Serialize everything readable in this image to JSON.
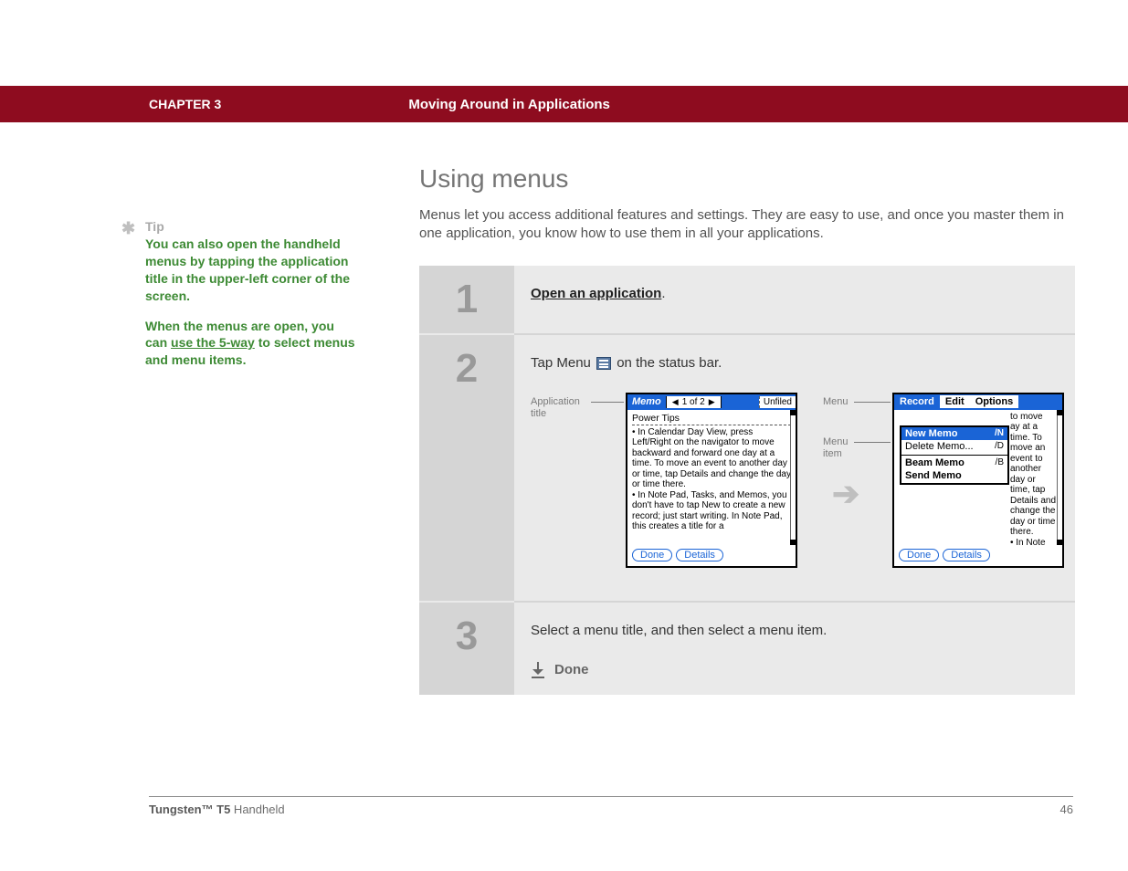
{
  "header": {
    "chapter": "CHAPTER 3",
    "title": "Moving Around in Applications"
  },
  "tip": {
    "label": "Tip",
    "p1": "You can also open the handheld menus by tapping the application title in the upper-left corner of the screen.",
    "p2a": "When the menus are open, you can ",
    "p2link": "use the 5-way",
    "p2b": " to select menus and menu items."
  },
  "section": {
    "title": "Using menus",
    "intro": "Menus let you access additional features and settings. They are easy to use, and once you master them in one application, you know how to use them in all your applications."
  },
  "steps": {
    "s1": {
      "num": "1",
      "link": "Open an application",
      "after": "."
    },
    "s2": {
      "num": "2",
      "prefix": "Tap Menu ",
      "suffix": " on the status bar.",
      "labels": {
        "app_title": "Application title",
        "menu": "Menu",
        "menu_item": "Menu item"
      },
      "shot1": {
        "app": "Memo",
        "nav": "1 of 2",
        "cat": "Unfiled",
        "heading": "Power Tips",
        "body": "• In Calendar Day View, press Left/Right on the navigator to move backward and forward one day at a time. To move an event to another day or time, tap Details and change the day or time there.\n• In Note Pad, Tasks, and Memos, you don't have to tap New to create a new record; just start writing. In Note Pad, this creates a title for a",
        "btn_done": "Done",
        "btn_details": "Details"
      },
      "shot2": {
        "menus": {
          "record": "Record",
          "edit": "Edit",
          "options": "Options"
        },
        "items": {
          "new_memo": "New Memo",
          "new_sc": "/N",
          "delete_memo": "Delete Memo...",
          "delete_sc": "/D",
          "beam_memo": "Beam Memo",
          "beam_sc": "/B",
          "send_memo": "Send Memo"
        },
        "body_tail": "to move\nay at a\ntime. To move an event to another day or time, tap Details and change the day or time there.\n• In Note Pad, Tasks, and Memos, you don't have to tap New to create a new record; just start writing. In Note Pad, this creates a title for a",
        "btn_done": "Done",
        "btn_details": "Details"
      }
    },
    "s3": {
      "num": "3",
      "text": "Select a menu title, and then select a menu item.",
      "done": "Done"
    }
  },
  "footer": {
    "product_bold": "Tungsten™ T5",
    "product_rest": " Handheld",
    "page": "46"
  }
}
